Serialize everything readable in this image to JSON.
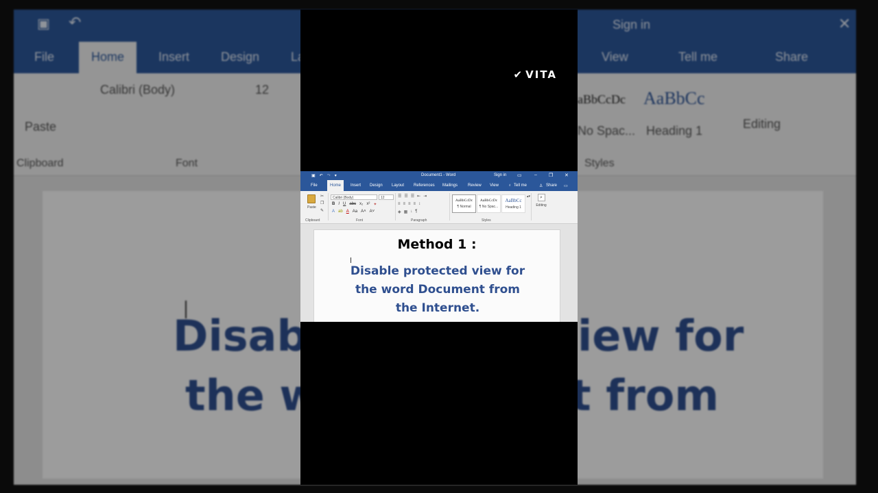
{
  "watermark": "VITA",
  "word": {
    "document_title": "Document1 - Word",
    "sign_in": "Sign in",
    "tabs": [
      "File",
      "Home",
      "Insert",
      "Design",
      "Layout",
      "References",
      "Mailings",
      "Review",
      "View",
      "Tell me",
      "Share"
    ],
    "active_tab": "Home",
    "font_name": "Calibri (Body)",
    "font_size": "12",
    "paste_label": "Paste",
    "groups": [
      "Clipboard",
      "Font",
      "Paragraph",
      "Styles"
    ],
    "styles": [
      {
        "sample": "AaBbCcDc",
        "name": "¶ Normal"
      },
      {
        "sample": "AaBbCcDc",
        "name": "¶ No Spac..."
      },
      {
        "sample": "AaBbCc",
        "name": "Heading 1"
      }
    ],
    "editing_label": "Editing"
  },
  "document": {
    "heading": "Method 1 :",
    "lines": [
      "Disable protected view for",
      "the word Document from",
      "the Internet."
    ]
  },
  "background": {
    "tabs": [
      "File",
      "Home",
      "Insert",
      "Design",
      "La",
      "View",
      "Tell me",
      "Share"
    ],
    "sign_in": "Sign in",
    "font_name": "Calibri (Body)",
    "font_size": "12",
    "paste_label": "Paste",
    "clipboard_label": "Clipboard",
    "font_label": "Font",
    "styles_label": "Styles",
    "style_sample": "aBbCcDc",
    "style_sample_2": "AaBbCc",
    "style_name_1": "No Spac...",
    "style_name_2": "Heading 1",
    "editing_label": "Editing",
    "big_left_1": "Disabl",
    "big_right_1": "iew for",
    "big_left_2": "the w",
    "big_right_2": "t from"
  }
}
